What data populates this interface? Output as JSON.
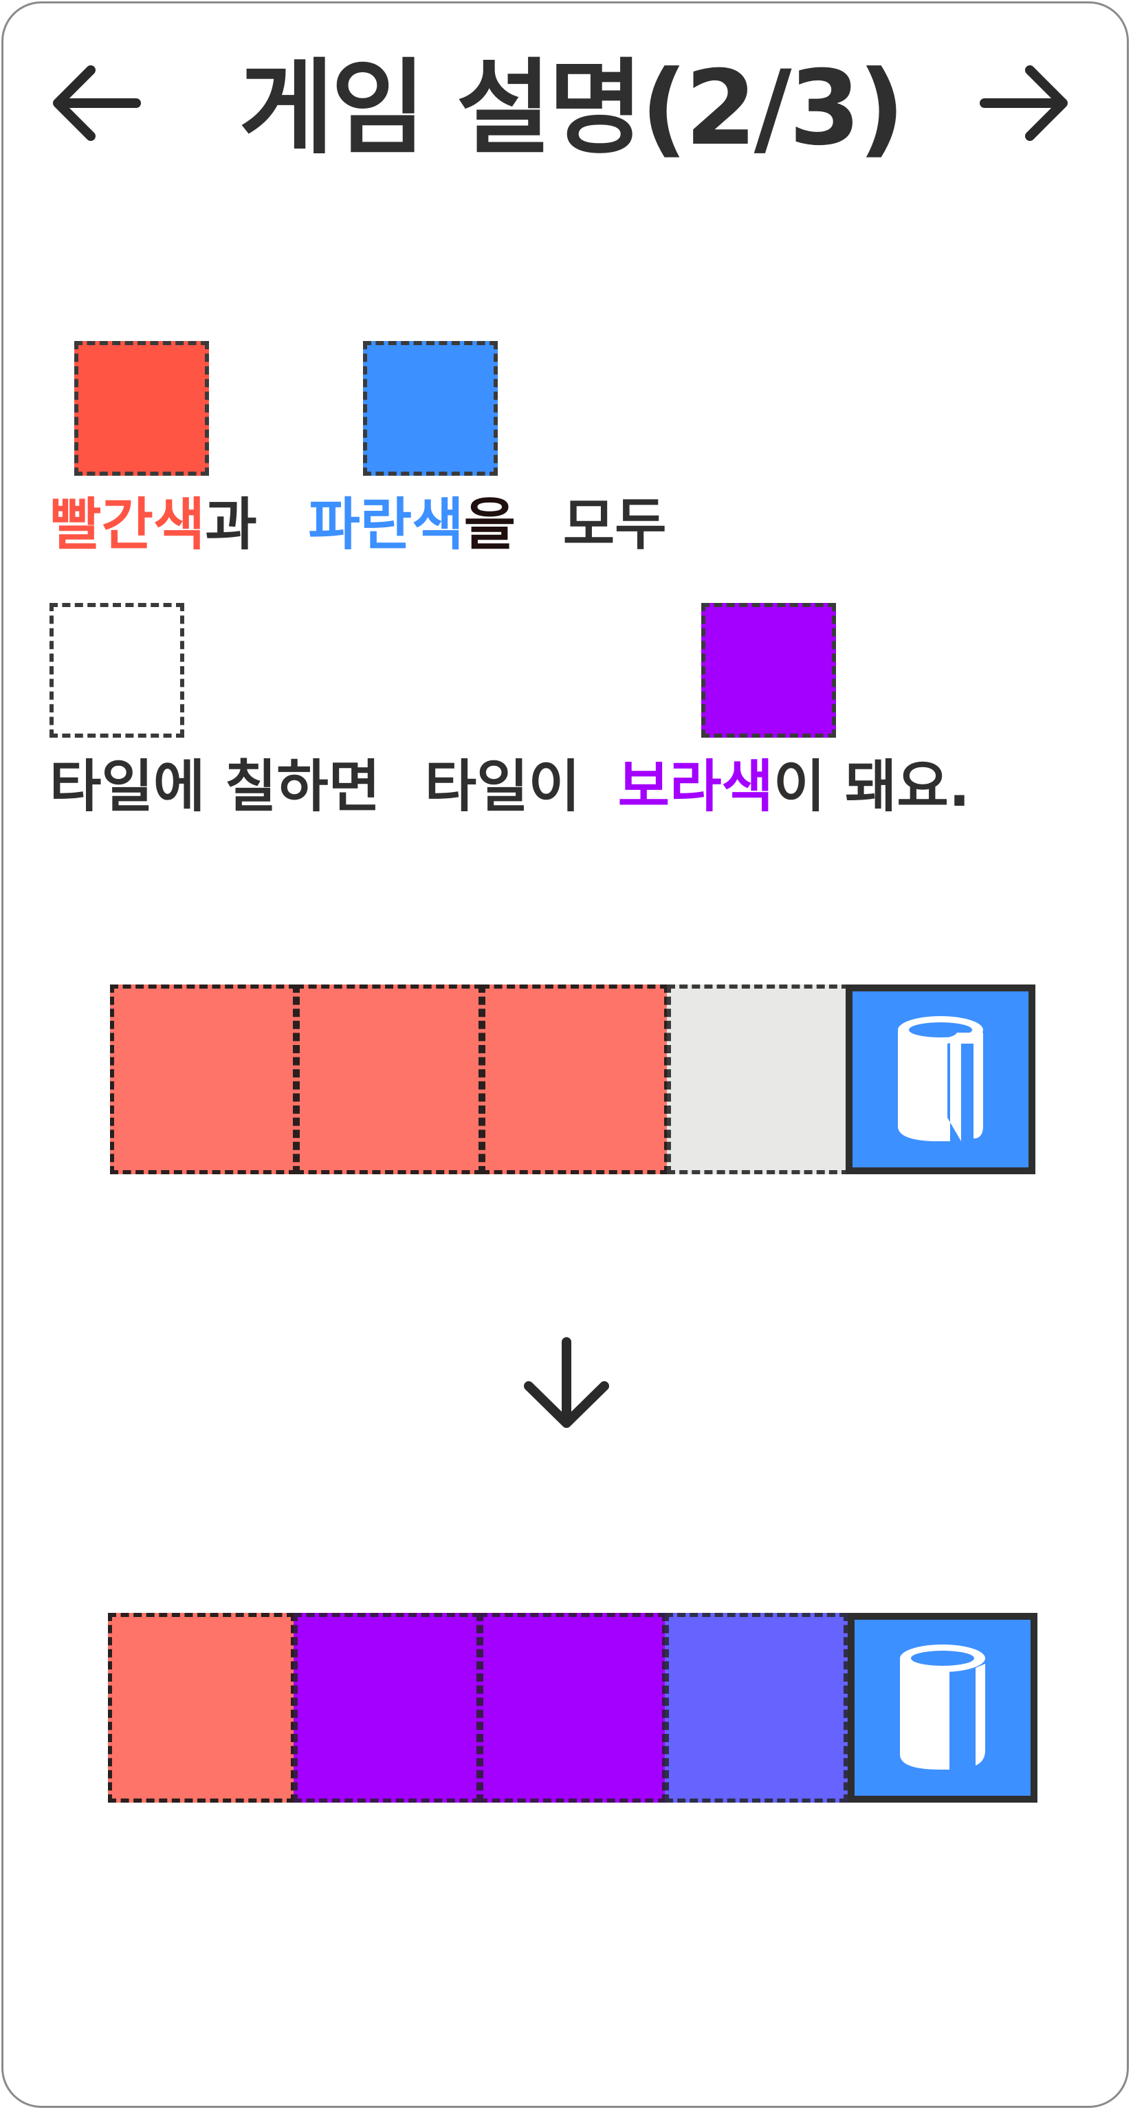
{
  "header": {
    "title": "게임 설명(2/3)",
    "prev_icon": "arrow-left-icon",
    "next_icon": "arrow-right-icon"
  },
  "colors": {
    "red": "#ff5545",
    "blue": "#3d90ff",
    "purple": "#a300ff",
    "text": "#2f2f2f",
    "light_red": "#ff7468",
    "empty_tile": "#e8e8e6",
    "mixed_blue": "#6663ff"
  },
  "line1": {
    "red_word": "빨간색",
    "and": "과",
    "blue_word": "파란색",
    "object_particle": "을",
    "all": "모두"
  },
  "line2": {
    "paint_clause": "타일에 칠하면",
    "tile_subject": "타일이",
    "purple_word": "보라색",
    "ending": "이 돼요."
  },
  "example_before": {
    "tiles": [
      "light_red",
      "light_red",
      "light_red",
      "empty"
    ],
    "bucket_icon": "paint-bucket-icon"
  },
  "arrow_icon": "arrow-down-icon",
  "example_after": {
    "tiles": [
      "light_red",
      "purple",
      "purple",
      "mixed_blue"
    ],
    "bucket_icon": "paint-bucket-icon"
  }
}
